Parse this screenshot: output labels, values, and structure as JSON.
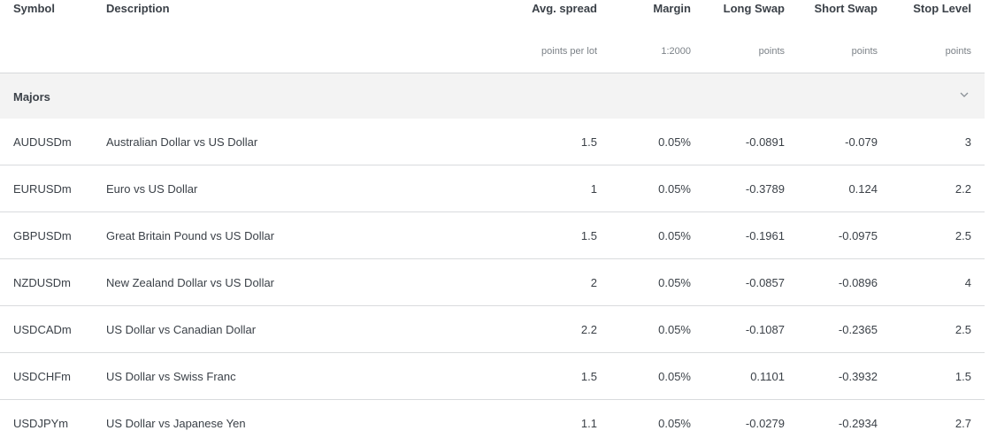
{
  "columns": {
    "symbol": "Symbol",
    "description": "Description",
    "spread": {
      "label": "Avg. spread",
      "unit": "points per lot"
    },
    "margin": {
      "label": "Margin",
      "unit": "1:2000"
    },
    "long_swap": {
      "label": "Long Swap",
      "unit": "points"
    },
    "short_swap": {
      "label": "Short Swap",
      "unit": "points"
    },
    "stop_level": {
      "label": "Stop Level",
      "unit": "points"
    }
  },
  "group": {
    "label": "Majors",
    "expanded": true,
    "icon": "chevron-down-icon"
  },
  "rows": [
    {
      "symbol": "AUDUSDm",
      "description": "Australian Dollar vs US Dollar",
      "spread": "1.5",
      "margin": "0.05%",
      "long_swap": "-0.0891",
      "short_swap": "-0.079",
      "stop_level": "3"
    },
    {
      "symbol": "EURUSDm",
      "description": "Euro vs US Dollar",
      "spread": "1",
      "margin": "0.05%",
      "long_swap": "-0.3789",
      "short_swap": "0.124",
      "stop_level": "2.2"
    },
    {
      "symbol": "GBPUSDm",
      "description": "Great Britain Pound vs US Dollar",
      "spread": "1.5",
      "margin": "0.05%",
      "long_swap": "-0.1961",
      "short_swap": "-0.0975",
      "stop_level": "2.5"
    },
    {
      "symbol": "NZDUSDm",
      "description": "New Zealand Dollar vs US Dollar",
      "spread": "2",
      "margin": "0.05%",
      "long_swap": "-0.0857",
      "short_swap": "-0.0896",
      "stop_level": "4"
    },
    {
      "symbol": "USDCADm",
      "description": "US Dollar vs Canadian Dollar",
      "spread": "2.2",
      "margin": "0.05%",
      "long_swap": "-0.1087",
      "short_swap": "-0.2365",
      "stop_level": "2.5"
    },
    {
      "symbol": "USDCHFm",
      "description": "US Dollar vs Swiss Franc",
      "spread": "1.5",
      "margin": "0.05%",
      "long_swap": "0.1101",
      "short_swap": "-0.3932",
      "stop_level": "1.5"
    },
    {
      "symbol": "USDJPYm",
      "description": "US Dollar vs Japanese Yen",
      "spread": "1.1",
      "margin": "0.05%",
      "long_swap": "-0.0279",
      "short_swap": "-0.2934",
      "stop_level": "2.7"
    }
  ]
}
